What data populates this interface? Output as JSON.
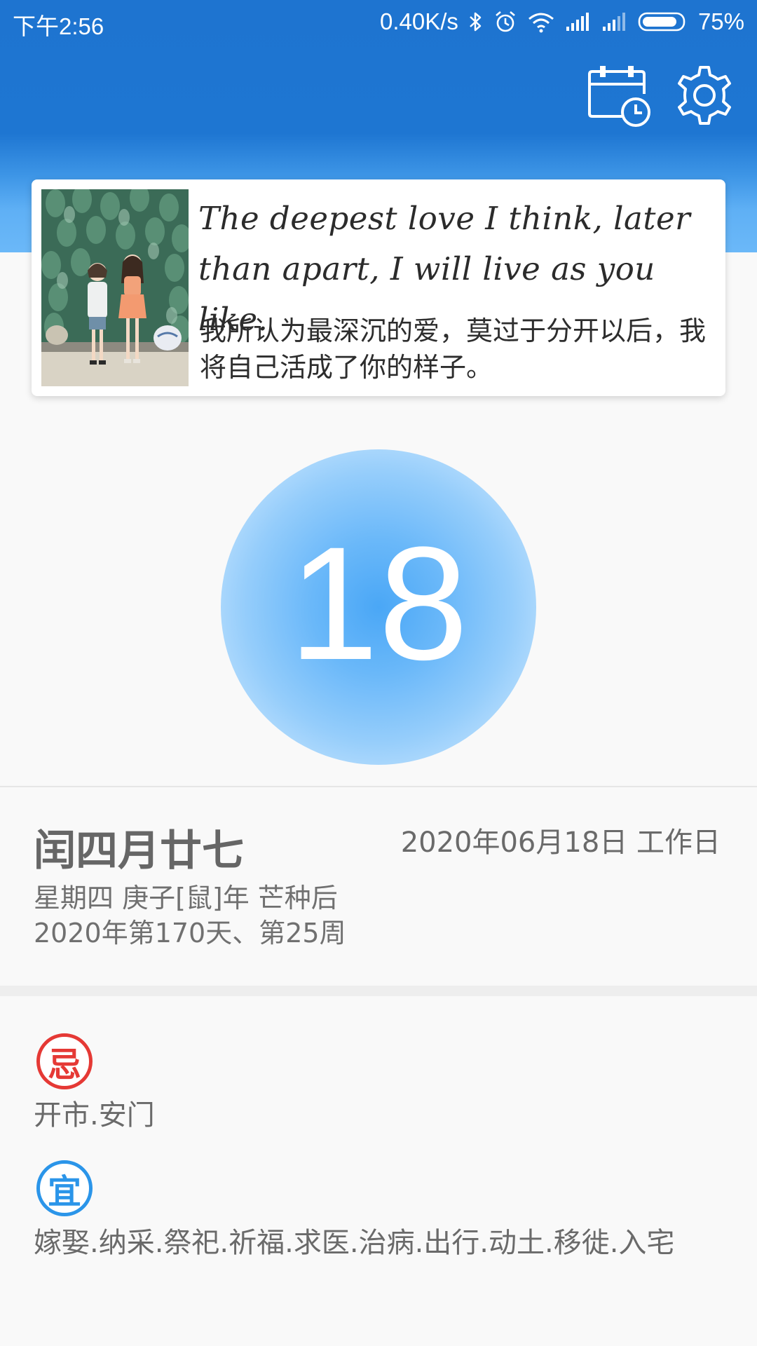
{
  "status_bar": {
    "time": "下午2:56",
    "network_speed": "0.40K/s",
    "battery": "75%",
    "icons": [
      "bluetooth-icon",
      "alarm-icon",
      "wifi-icon",
      "signal-icon",
      "signal-icon",
      "battery-icon"
    ]
  },
  "header": {
    "icons": [
      "calendar-clock-icon",
      "settings-gear-icon"
    ],
    "accent_color": "#1e76d2"
  },
  "quote": {
    "english": "The deepest love I think, later than apart, I will live as you like.",
    "chinese": "我所认为最深沉的爱，莫过于分开以后，我将自己活成了你的样子。"
  },
  "day": {
    "number": "18"
  },
  "date_info": {
    "lunar": "闰四月廿七",
    "solar": "2020年06月18日 工作日",
    "line1": "星期四 庚子[鼠]年 芒种后",
    "line2": "2020年第170天、第25周"
  },
  "almanac": {
    "avoid_badge": "忌",
    "avoid_color": "#e53935",
    "avoid_items": "开市.安门",
    "suit_badge": "宜",
    "suit_color": "#2b95e9",
    "suit_items": "嫁娶.纳采.祭祀.祈福.求医.治病.出行.动土.移徙.入宅"
  }
}
